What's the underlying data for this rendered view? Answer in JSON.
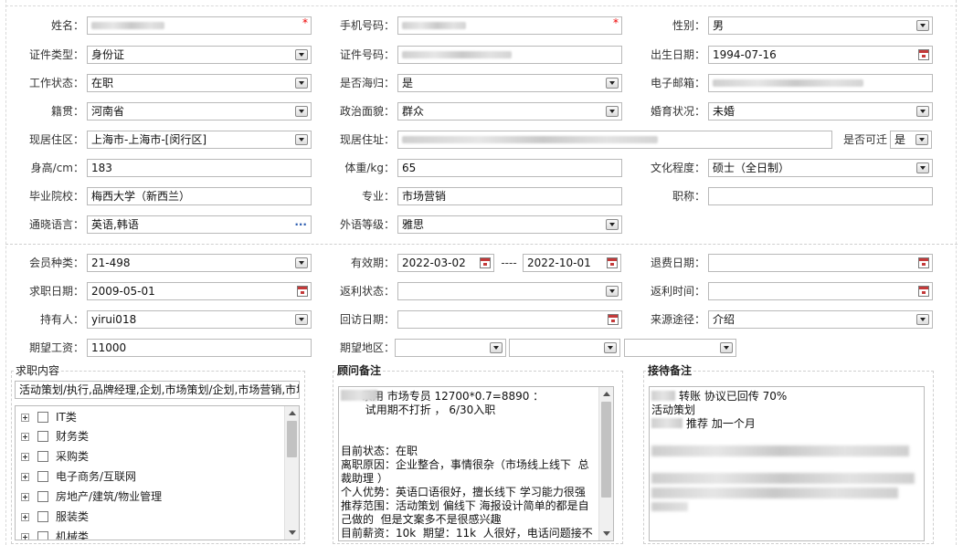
{
  "basic": {
    "name_label": "姓名：",
    "name_value": "",
    "phone_label": "手机号码：",
    "phone_value": "",
    "gender_label": "性别：",
    "gender_value": "男",
    "id_type_label": "证件类型：",
    "id_type_value": "身份证",
    "id_no_label": "证件号码：",
    "id_no_value": "",
    "birth_label": "出生日期：",
    "birth_value": "1994-07-16",
    "work_status_label": "工作状态：",
    "work_status_value": "在职",
    "overseas_label": "是否海归：",
    "overseas_value": "是",
    "email_label": "电子邮箱：",
    "email_value": "",
    "native_label": "籍贯：",
    "native_value": "河南省",
    "political_label": "政治面貌：",
    "political_value": "群众",
    "marital_label": "婚育状况：",
    "marital_value": "未婚",
    "residence_area_label": "现居住区：",
    "residence_area_value": "上海市-上海市-[闵行区]",
    "residence_addr_label": "现居住址：",
    "residence_addr_value": "",
    "relocate_label": "是否可迁",
    "relocate_value": "是",
    "height_label": "身高/cm：",
    "height_value": "183",
    "weight_label": "体重/kg：",
    "weight_value": "65",
    "education_label": "文化程度：",
    "education_value": "硕士（全日制）",
    "school_label": "毕业院校：",
    "school_value": "梅西大学（新西兰）",
    "major_label": "专业：",
    "major_value": "市场营销",
    "title_label": "职称：",
    "title_value": "",
    "language_label": "通晓语言：",
    "language_value": "英语,韩语",
    "foreign_level_label": "外语等级：",
    "foreign_level_value": "雅思"
  },
  "member": {
    "type_label": "会员种类：",
    "type_value": "21-498",
    "valid_label": "有效期：",
    "valid_from": "2022-03-02",
    "valid_sep": "----",
    "valid_to": "2022-10-01",
    "refund_date_label": "退费日期：",
    "refund_date_value": "",
    "job_date_label": "求职日期：",
    "job_date_value": "2009-05-01",
    "rebate_status_label": "返利状态：",
    "rebate_status_value": "",
    "rebate_time_label": "返利时间：",
    "rebate_time_value": "",
    "holder_label": "持有人：",
    "holder_value": "yirui018",
    "visit_date_label": "回访日期：",
    "visit_date_value": "",
    "source_label": "来源途径：",
    "source_value": "介绍",
    "salary_label": "期望工资：",
    "salary_value": "11000",
    "region_label": "期望地区："
  },
  "job_content": {
    "title": "求职内容",
    "summary": "活动策划/执行,品牌经理,企划,市场策划/企划,市场营销,市场",
    "tree": [
      "IT类",
      "财务类",
      "采购类",
      "电子商务/互联网",
      "房地产/建筑/物业管理",
      "服装类",
      "机械类"
    ]
  },
  "consultant_notes": {
    "title": "顾问备注",
    "text": "      录用 市场专员 12700*0.7=8890 ：\n       试用期不打折 ， 6/30入职\n\n\n目前状态：在职\n离职原因：企业整合，事情很杂（市场线上线下  总\n裁助理 ）\n个人优势：英语口语很好，擅长线下 学习能力很强\n推荐范围：活动策划 偏线下 海报设计简单的都是自\n己做的  但是文案多不是很感兴趣\n目前薪资：10k  期望：11k  人很好，电话问题接不"
  },
  "reception_notes": {
    "title": "接待备注",
    "line1": "转账 协议已回传 70%",
    "line2": "活动策划",
    "line3": "推荐 加一个月"
  }
}
